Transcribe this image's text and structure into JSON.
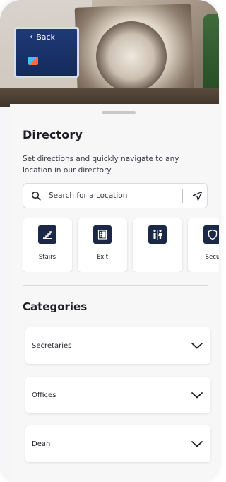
{
  "header": {
    "back_label": "Back"
  },
  "directory": {
    "title": "Directory",
    "subtitle": "Set directions and quickly navigate to any location in our directory",
    "search": {
      "placeholder": "Search for a Location",
      "value": ""
    }
  },
  "quick_access": [
    {
      "label": "Stairs",
      "icon": "stairs-icon"
    },
    {
      "label": "Exit",
      "icon": "exit-icon"
    },
    {
      "label": "",
      "icon": "restroom-icon"
    },
    {
      "label": "Secu",
      "icon": "security-icon"
    }
  ],
  "categories": {
    "title": "Categories",
    "items": [
      {
        "label": "Secretaries"
      },
      {
        "label": "Offices"
      },
      {
        "label": "Dean"
      }
    ]
  },
  "colors": {
    "icon_tile": "#1b2848",
    "background": "#f7f7f8"
  }
}
